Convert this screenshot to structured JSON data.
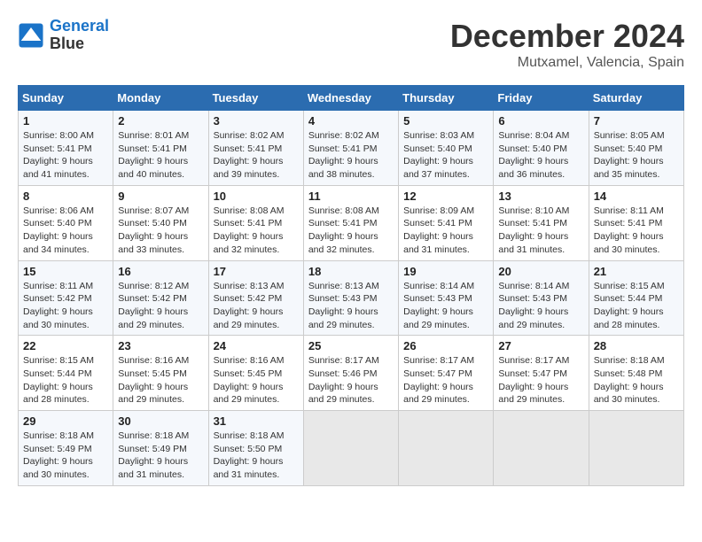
{
  "header": {
    "logo_line1": "General",
    "logo_line2": "Blue",
    "month": "December 2024",
    "location": "Mutxamel, Valencia, Spain"
  },
  "weekdays": [
    "Sunday",
    "Monday",
    "Tuesday",
    "Wednesday",
    "Thursday",
    "Friday",
    "Saturday"
  ],
  "weeks": [
    [
      {
        "day": "1",
        "sunrise": "8:00 AM",
        "sunset": "5:41 PM",
        "daylight": "9 hours and 41 minutes."
      },
      {
        "day": "2",
        "sunrise": "8:01 AM",
        "sunset": "5:41 PM",
        "daylight": "9 hours and 40 minutes."
      },
      {
        "day": "3",
        "sunrise": "8:02 AM",
        "sunset": "5:41 PM",
        "daylight": "9 hours and 39 minutes."
      },
      {
        "day": "4",
        "sunrise": "8:02 AM",
        "sunset": "5:41 PM",
        "daylight": "9 hours and 38 minutes."
      },
      {
        "day": "5",
        "sunrise": "8:03 AM",
        "sunset": "5:40 PM",
        "daylight": "9 hours and 37 minutes."
      },
      {
        "day": "6",
        "sunrise": "8:04 AM",
        "sunset": "5:40 PM",
        "daylight": "9 hours and 36 minutes."
      },
      {
        "day": "7",
        "sunrise": "8:05 AM",
        "sunset": "5:40 PM",
        "daylight": "9 hours and 35 minutes."
      }
    ],
    [
      {
        "day": "8",
        "sunrise": "8:06 AM",
        "sunset": "5:40 PM",
        "daylight": "9 hours and 34 minutes."
      },
      {
        "day": "9",
        "sunrise": "8:07 AM",
        "sunset": "5:40 PM",
        "daylight": "9 hours and 33 minutes."
      },
      {
        "day": "10",
        "sunrise": "8:08 AM",
        "sunset": "5:41 PM",
        "daylight": "9 hours and 32 minutes."
      },
      {
        "day": "11",
        "sunrise": "8:08 AM",
        "sunset": "5:41 PM",
        "daylight": "9 hours and 32 minutes."
      },
      {
        "day": "12",
        "sunrise": "8:09 AM",
        "sunset": "5:41 PM",
        "daylight": "9 hours and 31 minutes."
      },
      {
        "day": "13",
        "sunrise": "8:10 AM",
        "sunset": "5:41 PM",
        "daylight": "9 hours and 31 minutes."
      },
      {
        "day": "14",
        "sunrise": "8:11 AM",
        "sunset": "5:41 PM",
        "daylight": "9 hours and 30 minutes."
      }
    ],
    [
      {
        "day": "15",
        "sunrise": "8:11 AM",
        "sunset": "5:42 PM",
        "daylight": "9 hours and 30 minutes."
      },
      {
        "day": "16",
        "sunrise": "8:12 AM",
        "sunset": "5:42 PM",
        "daylight": "9 hours and 29 minutes."
      },
      {
        "day": "17",
        "sunrise": "8:13 AM",
        "sunset": "5:42 PM",
        "daylight": "9 hours and 29 minutes."
      },
      {
        "day": "18",
        "sunrise": "8:13 AM",
        "sunset": "5:43 PM",
        "daylight": "9 hours and 29 minutes."
      },
      {
        "day": "19",
        "sunrise": "8:14 AM",
        "sunset": "5:43 PM",
        "daylight": "9 hours and 29 minutes."
      },
      {
        "day": "20",
        "sunrise": "8:14 AM",
        "sunset": "5:43 PM",
        "daylight": "9 hours and 29 minutes."
      },
      {
        "day": "21",
        "sunrise": "8:15 AM",
        "sunset": "5:44 PM",
        "daylight": "9 hours and 28 minutes."
      }
    ],
    [
      {
        "day": "22",
        "sunrise": "8:15 AM",
        "sunset": "5:44 PM",
        "daylight": "9 hours and 28 minutes."
      },
      {
        "day": "23",
        "sunrise": "8:16 AM",
        "sunset": "5:45 PM",
        "daylight": "9 hours and 29 minutes."
      },
      {
        "day": "24",
        "sunrise": "8:16 AM",
        "sunset": "5:45 PM",
        "daylight": "9 hours and 29 minutes."
      },
      {
        "day": "25",
        "sunrise": "8:17 AM",
        "sunset": "5:46 PM",
        "daylight": "9 hours and 29 minutes."
      },
      {
        "day": "26",
        "sunrise": "8:17 AM",
        "sunset": "5:47 PM",
        "daylight": "9 hours and 29 minutes."
      },
      {
        "day": "27",
        "sunrise": "8:17 AM",
        "sunset": "5:47 PM",
        "daylight": "9 hours and 29 minutes."
      },
      {
        "day": "28",
        "sunrise": "8:18 AM",
        "sunset": "5:48 PM",
        "daylight": "9 hours and 30 minutes."
      }
    ],
    [
      {
        "day": "29",
        "sunrise": "8:18 AM",
        "sunset": "5:49 PM",
        "daylight": "9 hours and 30 minutes."
      },
      {
        "day": "30",
        "sunrise": "8:18 AM",
        "sunset": "5:49 PM",
        "daylight": "9 hours and 31 minutes."
      },
      {
        "day": "31",
        "sunrise": "8:18 AM",
        "sunset": "5:50 PM",
        "daylight": "9 hours and 31 minutes."
      },
      null,
      null,
      null,
      null
    ]
  ]
}
